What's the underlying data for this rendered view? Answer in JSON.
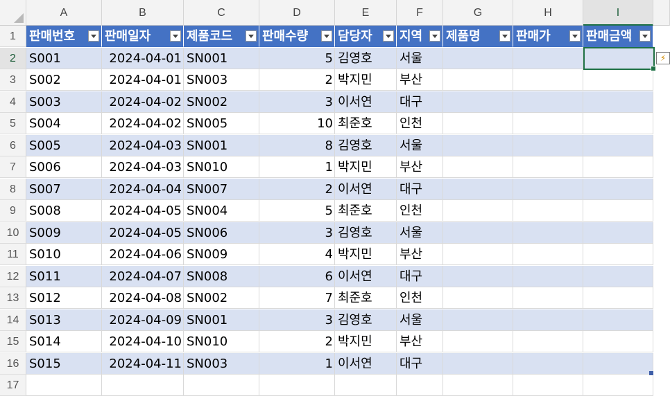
{
  "columns": [
    "A",
    "B",
    "C",
    "D",
    "E",
    "F",
    "G",
    "H",
    "I"
  ],
  "selected_column": "I",
  "selected_row": 2,
  "headers": [
    "판매번호",
    "판매일자",
    "제품코드",
    "판매수량",
    "담당자",
    "지역",
    "제품명",
    "판매가",
    "판매금액"
  ],
  "rows": [
    [
      "S001",
      "2024-04-01",
      "SN001",
      "5",
      "김영호",
      "서울",
      "",
      "",
      ""
    ],
    [
      "S002",
      "2024-04-01",
      "SN003",
      "2",
      "박지민",
      "부산",
      "",
      "",
      ""
    ],
    [
      "S003",
      "2024-04-02",
      "SN002",
      "3",
      "이서연",
      "대구",
      "",
      "",
      ""
    ],
    [
      "S004",
      "2024-04-02",
      "SN005",
      "10",
      "최준호",
      "인천",
      "",
      "",
      ""
    ],
    [
      "S005",
      "2024-04-03",
      "SN001",
      "8",
      "김영호",
      "서울",
      "",
      "",
      ""
    ],
    [
      "S006",
      "2024-04-03",
      "SN010",
      "1",
      "박지민",
      "부산",
      "",
      "",
      ""
    ],
    [
      "S007",
      "2024-04-04",
      "SN007",
      "2",
      "이서연",
      "대구",
      "",
      "",
      ""
    ],
    [
      "S008",
      "2024-04-05",
      "SN004",
      "5",
      "최준호",
      "인천",
      "",
      "",
      ""
    ],
    [
      "S009",
      "2024-04-05",
      "SN006",
      "3",
      "김영호",
      "서울",
      "",
      "",
      ""
    ],
    [
      "S010",
      "2024-04-06",
      "SN009",
      "4",
      "박지민",
      "부산",
      "",
      "",
      ""
    ],
    [
      "S011",
      "2024-04-07",
      "SN008",
      "6",
      "이서연",
      "대구",
      "",
      "",
      ""
    ],
    [
      "S012",
      "2024-04-08",
      "SN002",
      "7",
      "최준호",
      "인천",
      "",
      "",
      ""
    ],
    [
      "S013",
      "2024-04-09",
      "SN001",
      "3",
      "김영호",
      "서울",
      "",
      "",
      ""
    ],
    [
      "S014",
      "2024-04-10",
      "SN010",
      "2",
      "박지민",
      "부산",
      "",
      "",
      ""
    ],
    [
      "S015",
      "2024-04-11",
      "SN003",
      "1",
      "이서연",
      "대구",
      "",
      "",
      ""
    ]
  ],
  "row_numbers": [
    "1",
    "2",
    "3",
    "4",
    "5",
    "6",
    "7",
    "8",
    "9",
    "10",
    "11",
    "12",
    "13",
    "14",
    "15",
    "16",
    "17"
  ],
  "colors": {
    "table_header": "#4472c4",
    "band": "#d9e1f2",
    "selection": "#1e7145"
  }
}
